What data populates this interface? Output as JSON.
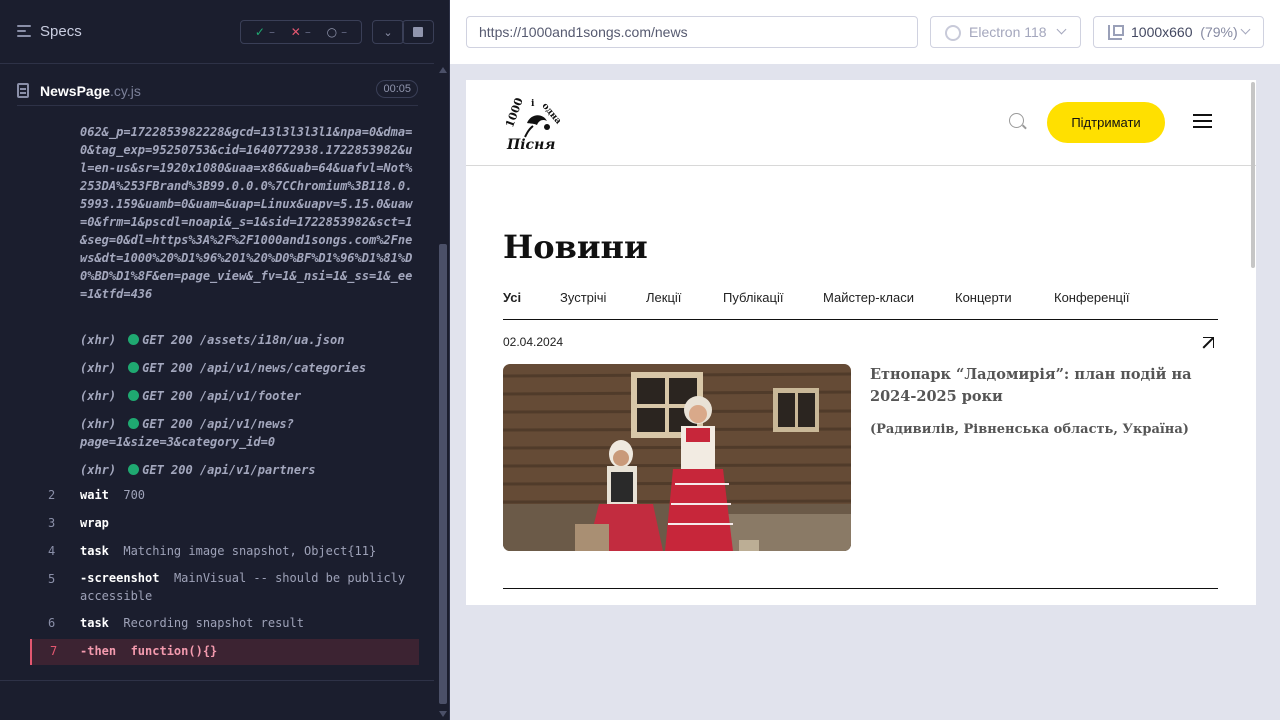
{
  "runner": {
    "specs_label": "Specs",
    "stats": {
      "passed": "–",
      "failed": "–",
      "pending": "–"
    },
    "spec_file": {
      "name": "NewsPage",
      "ext": ".cy.js",
      "duration": "00:05"
    },
    "url_fragment": "062&_p=1722853982228&gcd=13l3l3l3l1&npa=0&dma=0&tag_exp=95250753&cid=1640772938.1722853982&ul=en-us&sr=1920x1080&uaa=x86&uab=64&uafvl=Not%253DA%253FBrand%3B99.0.0.0%7CChromium%3B118.0.5993.159&uamb=0&uam=&uap=Linux&uapv=5.15.0&uaw=0&frm=1&pscdl=noapi&_s=1&sid=1722853982&sct=1&seg=0&dl=https%3A%2F%2F1000and1songs.com%2Fnews&dt=1000%20%D1%96%201%20%D0%BF%D1%96%D1%81%D0%BD%D1%8F&en=page_view&_fv=1&_nsi=1&_ss=1&_ee=1&tfd=436",
    "xhr": [
      {
        "tag": "(xhr)",
        "text": "GET 200 /assets/i18n/ua.json"
      },
      {
        "tag": "(xhr)",
        "text": "GET 200 /api/v1/news/categories"
      },
      {
        "tag": "(xhr)",
        "text": "GET 200 /api/v1/footer"
      },
      {
        "tag": "(xhr)",
        "text": "GET 200 /api/v1/news?page=1&size=3&category_id=0"
      },
      {
        "tag": "(xhr)",
        "text": "GET 200 /api/v1/partners"
      }
    ],
    "commands": [
      {
        "num": "2",
        "name": "wait",
        "msg": "700"
      },
      {
        "num": "3",
        "name": "wrap",
        "msg": ""
      },
      {
        "num": "4",
        "name": "task",
        "msg": "Matching image snapshot, Object{11}"
      },
      {
        "num": "5",
        "name": "-screenshot",
        "msg": "MainVisual -- should be publicly accessible"
      },
      {
        "num": "6",
        "name": "task",
        "msg": "Recording snapshot result"
      },
      {
        "num": "7",
        "name": "-then",
        "msg": "function(){}"
      }
    ]
  },
  "browser": {
    "url": "https://1000and1songs.com/news",
    "engine": "Electron 118",
    "viewport": "1000x660",
    "zoom": "(79%)"
  },
  "site": {
    "support_label": "Підтримати",
    "page_title": "Новини",
    "tabs": [
      "Усі",
      "Зустрічі",
      "Лекції",
      "Публікації",
      "Майстер-класи",
      "Концерти",
      "Конференції"
    ],
    "news": {
      "date": "02.04.2024",
      "title": "Етнопарк “Ладомирія”: план подій на 2024-2025 роки",
      "location": "(Радивилів, Рівненська область, Україна)"
    },
    "colors": {
      "accent": "#ffe000",
      "pass": "#1fa971",
      "fail": "#e45770"
    }
  }
}
